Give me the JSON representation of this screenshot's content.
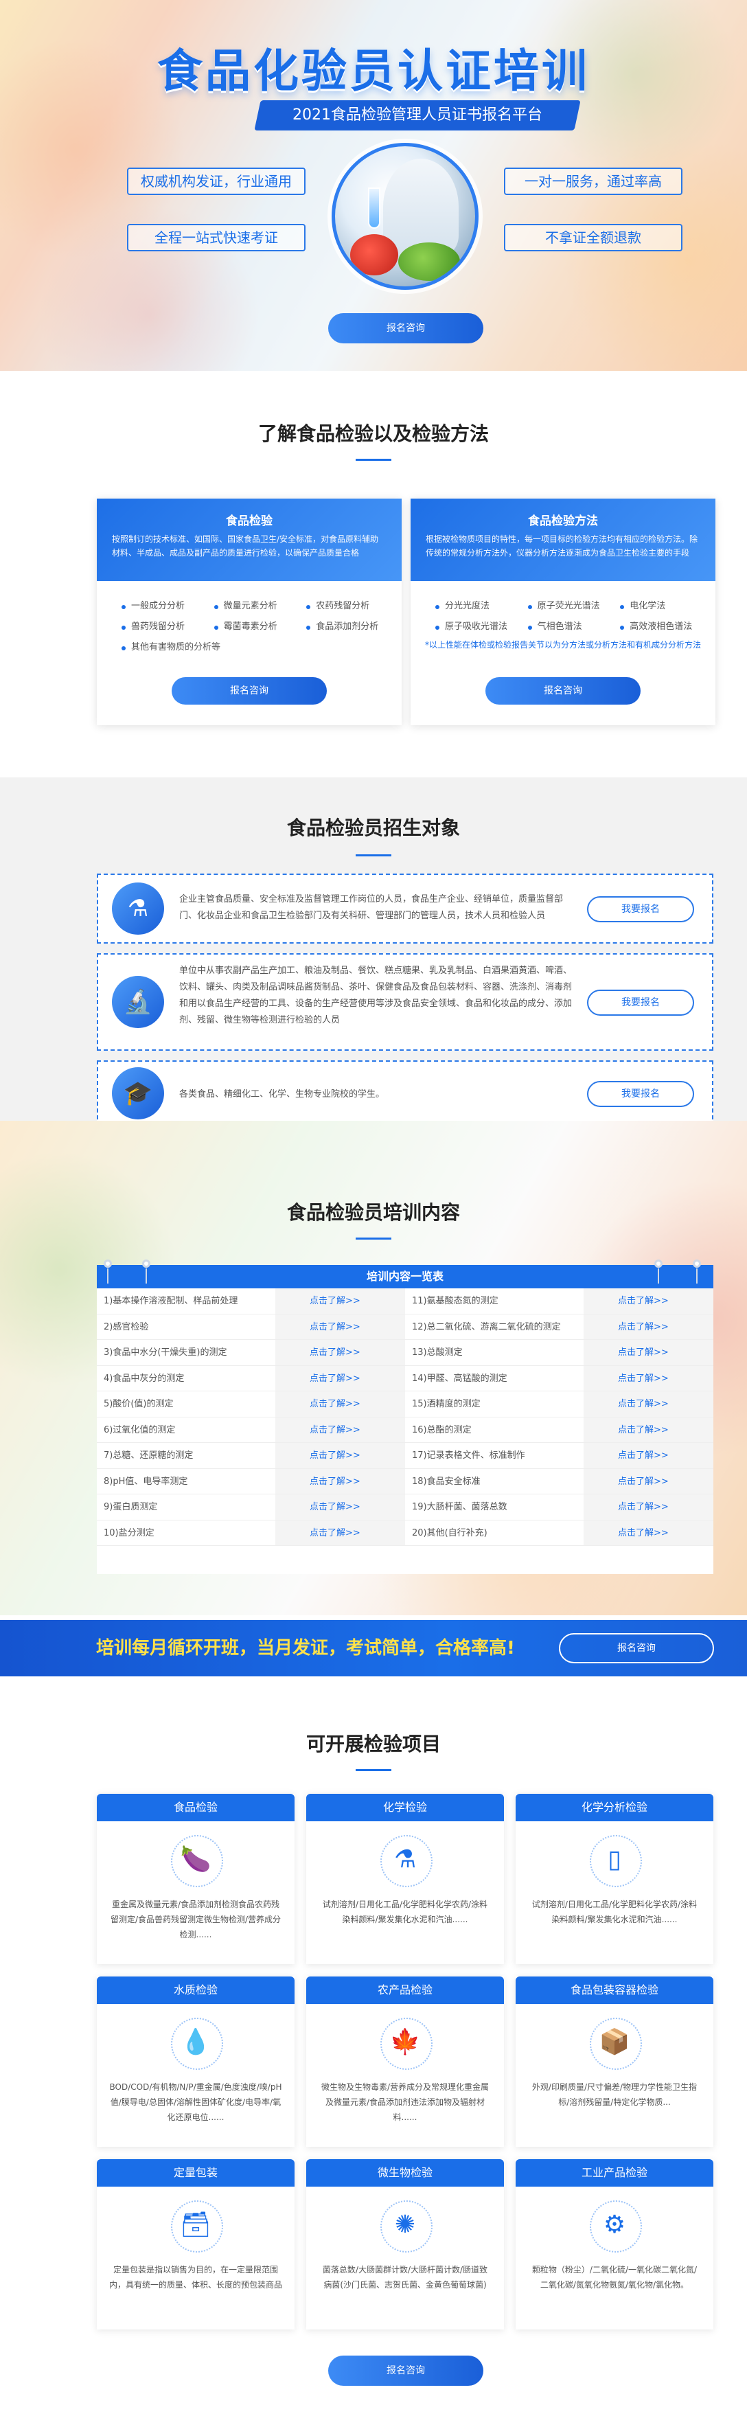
{
  "hero": {
    "title": "食品化验员认证培训",
    "subtitle": "2021食品检验管理人员证书报名平台",
    "pills": [
      "权威机构发证，行业通用",
      "全程一站式快速考证",
      "一对一服务，通过率高",
      "不拿证全额退款"
    ],
    "button": "报名咨询"
  },
  "methods": {
    "title": "了解食品检验以及检验方法",
    "cards": [
      {
        "title": "食品检验",
        "desc": "按照制订的技术标准、如国际、国家食品卫生/安全标准，对食品原料辅助材料、半成品、成品及副产品的质量进行检验，以确保产品质量合格",
        "items": [
          "一般成分分析",
          "微量元素分析",
          "农药残留分析",
          "兽药残留分析",
          "霉菌毒素分析",
          "食品添加剂分析",
          "其他有害物质的分析等"
        ],
        "note": "",
        "button": "报名咨询"
      },
      {
        "title": "食品检验方法",
        "desc": "根据被检物质项目的特性，每一项目标的检验方法均有相应的检验方法。除传统的常规分析方法外，仪器分析方法逐渐成为食品卫生检验主要的手段",
        "items": [
          "分光光度法",
          "原子荧光光谱法",
          "电化学法",
          "原子吸收光谱法",
          "气相色谱法",
          "高效液相色谱法"
        ],
        "note": "*以上性能在体检或检验报告关节以为分方法或分析方法和有机成分分析方法",
        "button": "报名咨询"
      }
    ]
  },
  "targets": {
    "title": "食品检验员招生对象",
    "items": [
      {
        "icon": "flask-icon",
        "text": "企业主管食品质量、安全标准及监督管理工作岗位的人员，食品生产企业、经销单位，质量监督部门、化妆品企业和食品卫生检验部门及有关科研、管理部门的管理人员，技术人员和检验人员",
        "button": "我要报名"
      },
      {
        "icon": "microscope-icon",
        "text": "单位中从事农副产品生产加工、粮油及制品、餐饮、糕点糖果、乳及乳制品、白酒果酒黄酒、啤酒、饮料、罐头、肉类及制品调味品酱货制品、茶叶、保健食品及食品包装材料、容器、洗涤剂、消毒剂和用以食品生产经营的工具、设备的生产经营使用等涉及食品安全领域、食品和化妆品的成分、添加剂、残留、微生物等检测进行检验的人员",
        "button": "我要报名"
      },
      {
        "icon": "graduate-icon",
        "text": "各类食品、精细化工、化学、生物专业院校的学生。",
        "button": "我要报名"
      }
    ]
  },
  "training": {
    "title": "食品检验员培训内容",
    "table_title": "培训内容一览表",
    "link_text": "点击了解>>",
    "left": [
      "1)基本操作溶液配制、样品前处理",
      "2)感官检验",
      "3)食品中水分(干燥失重)的测定",
      "4)食品中灰分的测定",
      "5)酸价(值)的测定",
      "6)过氧化值的测定",
      "7)总糖、还原糖的测定",
      "8)pH值、电导率测定",
      "9)蛋白质测定",
      "10)盐分测定"
    ],
    "right": [
      "11)氨基酸态氮的测定",
      "12)总二氧化硫、游离二氧化硫的测定",
      "13)总酸测定",
      "14)甲醛、高锰酸的测定",
      "15)酒精度的测定",
      "16)总酯的测定",
      "17)记录表格文件、标准制作",
      "18)食品安全标准",
      "19)大肠杆菌、菌落总数",
      "20)其他(自行补充)"
    ]
  },
  "banner": {
    "text": "培训每月循环开班，当月发证，考试简单，合格率高!",
    "button": "报名咨询"
  },
  "projects": {
    "title": "可开展检验项目",
    "items": [
      {
        "title": "食品检验",
        "icon": "eggplant-icon",
        "desc": "重金属及微量元素/食品添加剂检测食品农药残留测定/食品兽药残留测定微生物检测/营养成分检测......"
      },
      {
        "title": "化学检验",
        "icon": "beaker-icon",
        "desc": "试剂溶剂/日用化工品/化学肥料化学农药/涂料染料颜料/聚发集化水泥和汽油......"
      },
      {
        "title": "化学分析检验",
        "icon": "cylinder-icon",
        "desc": "试剂溶剂/日用化工品/化学肥料化学农药/涂料染料颜料/聚发集化水泥和汽油......"
      },
      {
        "title": "水质检验",
        "icon": "water-drop-icon",
        "desc": "BOD/COD/有机物/N/P/重金属/色度浊度/嗅/pH值/膜导电/总固体/溶解性固体矿化度/电导率/氧化还原电位......"
      },
      {
        "title": "农产品检验",
        "icon": "leaf-icon",
        "desc": "微生物及生物毒素/营养成分及常规理化重金属及微量元素/食品添加剂违法添加物及辐射材料......"
      },
      {
        "title": "食品包装容器检验",
        "icon": "package-icon",
        "desc": "外观/印刷质量/尺寸偏差/物理力学性能卫生指标/溶剂残留量/特定化学物质..."
      },
      {
        "title": "定量包装",
        "icon": "box-icon",
        "desc": "定量包装是指以销售为目的，在一定量限范围内，具有统一的质量、体积、长度的预包装商品"
      },
      {
        "title": "微生物检验",
        "icon": "bacteria-icon",
        "desc": "菌落总数/大肠菌群计数/大肠杆菌计数/肠道致病菌(沙门氏菌、志贺氏菌、金黄色葡萄球菌)"
      },
      {
        "title": "工业产品检验",
        "icon": "gear-icon",
        "desc": "颗粒物（粉尘）/二氧化硫/一氧化碳二氧化氮/二氧化碳/氮氧化物氨氮/氧化物/氯化物。"
      }
    ],
    "button": "报名咨询"
  }
}
